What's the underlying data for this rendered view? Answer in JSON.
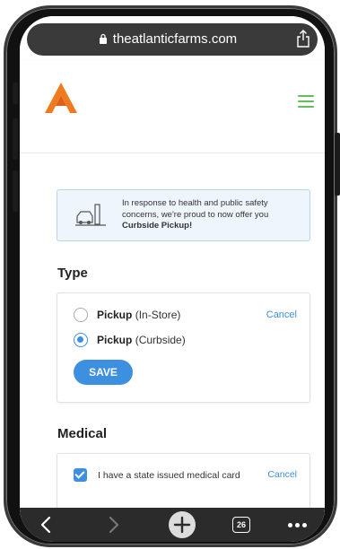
{
  "browser": {
    "url": "theatlanticfarms.com",
    "tabs_count": "26"
  },
  "site": {
    "logo_color": "#f07a1f",
    "menu_color": "#5fbf5a"
  },
  "notice": {
    "line1": "In response to health and public safety concerns, we're proud to now offer you",
    "highlight": "Curbside Pickup!"
  },
  "type_section": {
    "title": "Type",
    "options": [
      {
        "bold": "Pickup",
        "rest": "(In-Store)",
        "selected": false
      },
      {
        "bold": "Pickup",
        "rest": "(Curbside)",
        "selected": true
      }
    ],
    "cancel_label": "Cancel",
    "save_label": "SAVE"
  },
  "medical_section": {
    "title": "Medical",
    "checkbox_label": "I have a state issued medical card",
    "checked": true,
    "cancel_label": "Cancel"
  },
  "colors": {
    "accent": "#3d8fe0",
    "notice_bg": "#eef5fc",
    "success_bg": "#eff9ee"
  },
  "icons": {
    "lock": "lock-icon",
    "share": "share-icon",
    "menu": "hamburger-icon",
    "truck": "curbside-truck-icon",
    "back": "chevron-left-icon",
    "forward": "chevron-right-icon",
    "new_tab": "plus-icon",
    "more": "more-icon"
  }
}
